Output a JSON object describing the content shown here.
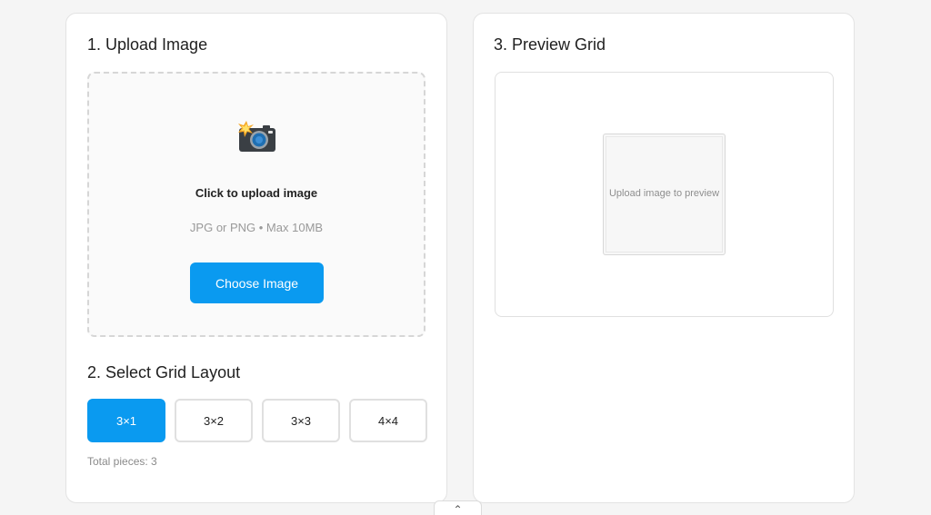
{
  "upload_section": {
    "title": "1. Upload Image",
    "prompt": "Click to upload image",
    "hint": "JPG or PNG • Max 10MB",
    "choose_label": "Choose Image"
  },
  "grid_section": {
    "title": "2. Select Grid Layout",
    "options": [
      "3×1",
      "3×2",
      "3×3",
      "4×4"
    ],
    "selected": "3×1",
    "total_pieces": "Total pieces: 3"
  },
  "preview_section": {
    "title": "3. Preview Grid",
    "placeholder": "Upload image to preview"
  },
  "scroll_top": {
    "icon": "chevron-up-icon",
    "glyph": "⌃"
  },
  "colors": {
    "accent": "#0a9af0",
    "background": "#f5f5f5"
  }
}
